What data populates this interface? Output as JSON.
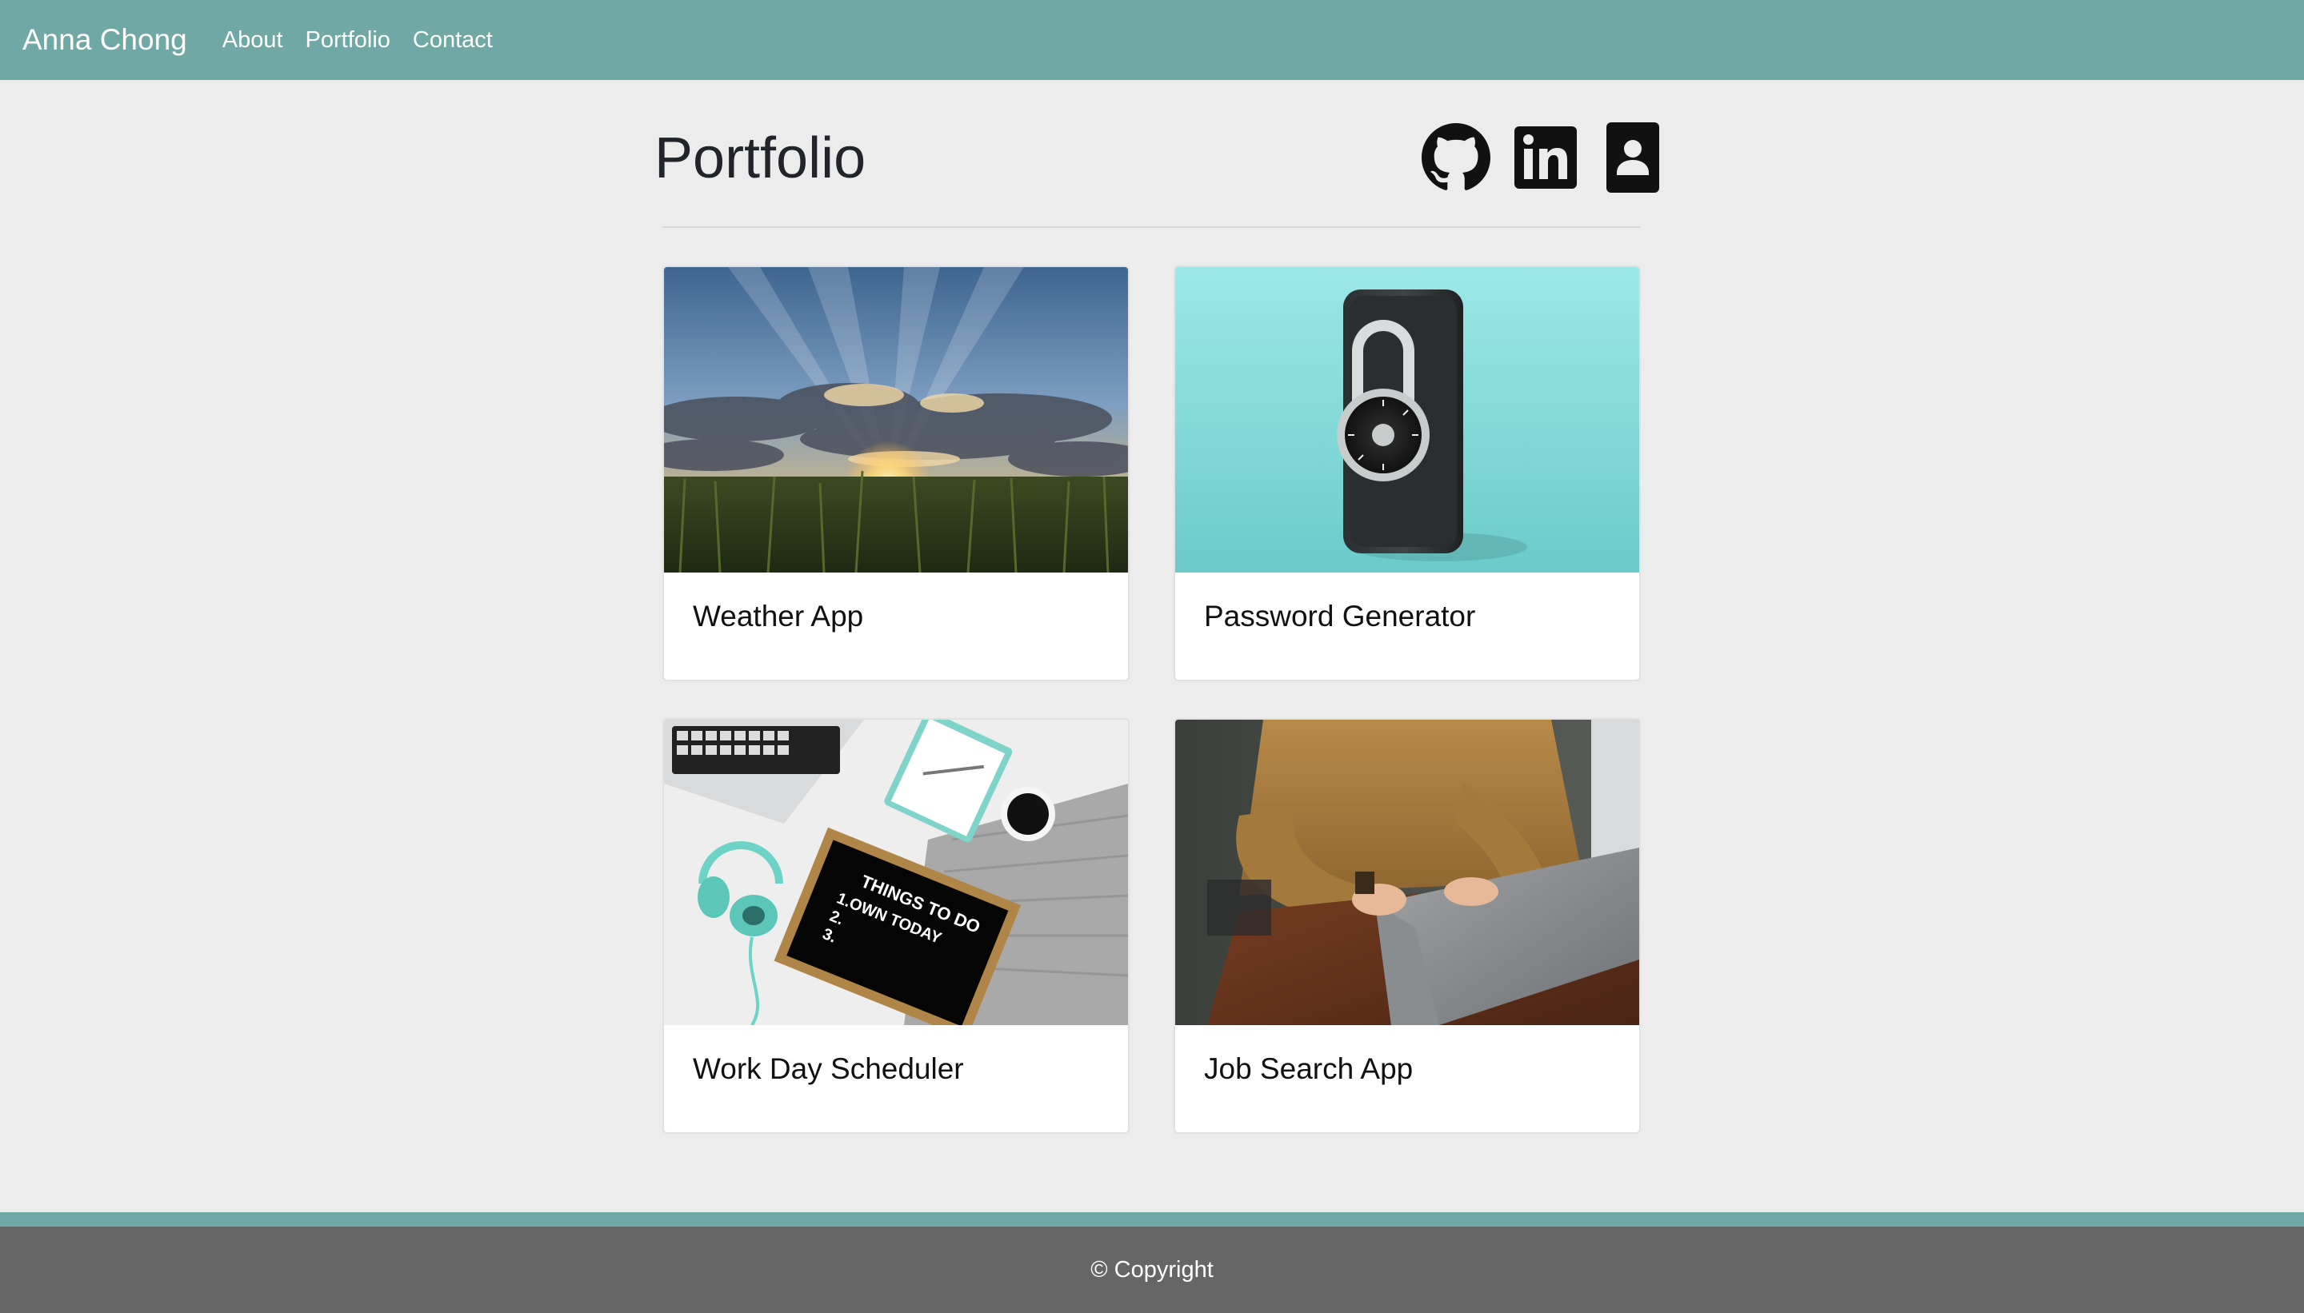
{
  "navbar": {
    "brand": "Anna Chong",
    "links": [
      "About",
      "Portfolio",
      "Contact"
    ]
  },
  "header": {
    "title": "Portfolio",
    "social_icons": [
      "github-icon",
      "linkedin-icon",
      "contact-card-icon"
    ]
  },
  "projects": [
    {
      "title": "Weather App",
      "image": "sunset-field-photo"
    },
    {
      "title": "Password Generator",
      "image": "phone-padlock-photo"
    },
    {
      "title": "Work Day Scheduler",
      "image": "desk-todo-board-photo",
      "image_text": [
        "THINGS TO DO",
        "1.OWN TODAY",
        "2.",
        "3."
      ]
    },
    {
      "title": "Job Search App",
      "image": "laptop-typing-photo"
    }
  ],
  "footer": {
    "copyright": "© Copyright"
  },
  "colors": {
    "navbar": "#6fa8a4",
    "background": "#ececec",
    "footer": "#666666",
    "card": "#ffffff"
  }
}
